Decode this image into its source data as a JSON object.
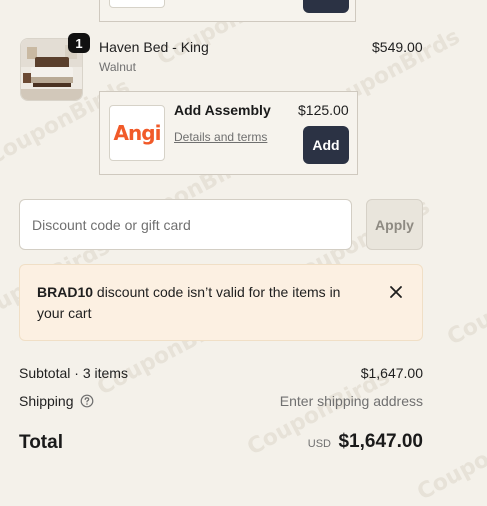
{
  "top_addon": {
    "button_label": ""
  },
  "product": {
    "quantity": "1",
    "title": "Haven Bed - King",
    "variant": "Walnut",
    "price": "$549.00",
    "image_icon": "bed-photo"
  },
  "addon": {
    "logo_text": "Angi",
    "title": "Add Assembly",
    "link_label": "Details and terms",
    "price": "$125.00",
    "button_label": "Add"
  },
  "discount": {
    "placeholder": "Discount code or gift card",
    "value": "",
    "apply_label": "Apply"
  },
  "error": {
    "code": "BRAD10",
    "message": " discount code isn’t valid for the items in your cart",
    "close_icon": "close-icon"
  },
  "summary": {
    "subtotal_label": "Subtotal · 3 items",
    "subtotal_value": "$1,647.00",
    "shipping_label": "Shipping",
    "shipping_value": "Enter shipping address",
    "total_label": "Total",
    "currency": "USD",
    "total_value": "$1,647.00"
  },
  "watermark": "CouponBirds",
  "colors": {
    "page_bg": "#f4f1ea",
    "button_dark": "#2b3244",
    "error_bg": "#fcf0e2",
    "brand_logo": "#f15a29"
  }
}
